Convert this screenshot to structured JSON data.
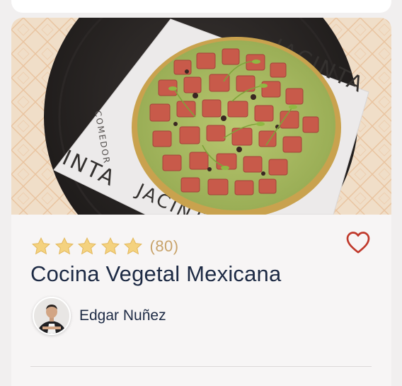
{
  "theme": {
    "page_bg": "#f1efef",
    "card_bg": "#f7f5f5",
    "title_color": "#1d2a44",
    "star_color": "#f4d27f",
    "count_color": "#c8a36a",
    "heart_color": "#c0392b"
  },
  "recipe": {
    "photo_alt": "Tostada de atún con aguacate sobre plato negro",
    "placemat_text": "JACINTA",
    "placemat_text_2": "INTA",
    "placemat_text_3": "COMEDOR",
    "rating": {
      "stars": 5,
      "max_stars": 5,
      "count": "(80)"
    },
    "title": "Cocina Vegetal Mexicana",
    "favorite_icon": "heart-outline-icon",
    "author": {
      "name": "Edgar Nuñez",
      "avatar_icon": "chef-avatar"
    }
  }
}
